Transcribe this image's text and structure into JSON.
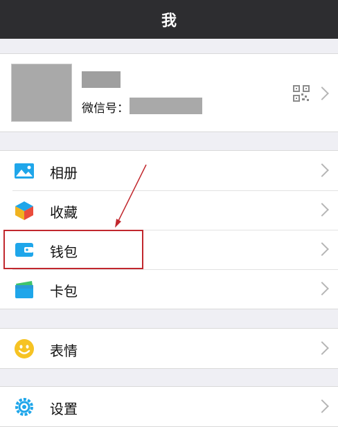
{
  "header": {
    "title": "我"
  },
  "profile": {
    "wechat_id_label": "微信号："
  },
  "menu_group1": [
    {
      "label": "相册",
      "icon": "photo-album-icon"
    },
    {
      "label": "收藏",
      "icon": "favorites-cube-icon"
    },
    {
      "label": "钱包",
      "icon": "wallet-icon"
    },
    {
      "label": "卡包",
      "icon": "card-holder-icon"
    }
  ],
  "menu_group2": [
    {
      "label": "表情",
      "icon": "smiley-icon"
    }
  ],
  "menu_group3": [
    {
      "label": "设置",
      "icon": "settings-gear-icon"
    }
  ],
  "colors": {
    "topbar": "#2d2d30",
    "accent_blue": "#1fa6ea",
    "annotation_red": "#c1272d"
  }
}
